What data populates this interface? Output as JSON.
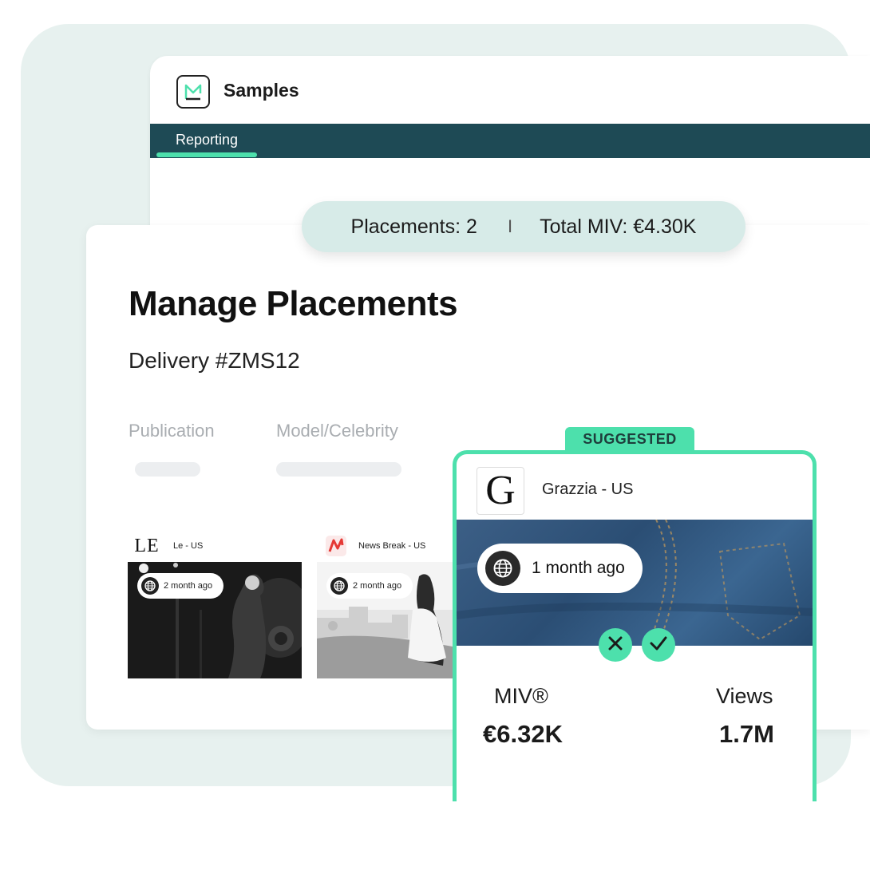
{
  "app": {
    "title": "Samples",
    "nav_tab": "Reporting"
  },
  "summary": {
    "placements": "Placements: 2",
    "separator": "I",
    "total_miv": "Total MIV: €4.30K"
  },
  "page": {
    "title": "Manage Placements",
    "subtitle": "Delivery #ZMS12"
  },
  "columns": [
    "Publication",
    "Model/Celebrity"
  ],
  "placements": [
    {
      "logo_text": "LE",
      "name": "Le - US",
      "badge": "2 month ago"
    },
    {
      "logo_text": "",
      "name": "News Break - US",
      "badge": "2 month ago"
    }
  ],
  "suggested": {
    "tag": "SUGGESTED",
    "logo_text": "G",
    "publication": "Grazzia - US",
    "badge": "1 month ago",
    "miv_label": "MIV®",
    "miv_value": "€6.32K",
    "views_label": "Views",
    "views_value": "1.7M"
  },
  "colors": {
    "accent": "#4de0ac",
    "navbar": "#1e4a55",
    "panel_bg": "#e7f1ef",
    "pill_bg": "#d7ebe8"
  },
  "icons": [
    "logo-icon",
    "globe-icon",
    "close-icon",
    "check-icon",
    "news-break-icon"
  ]
}
